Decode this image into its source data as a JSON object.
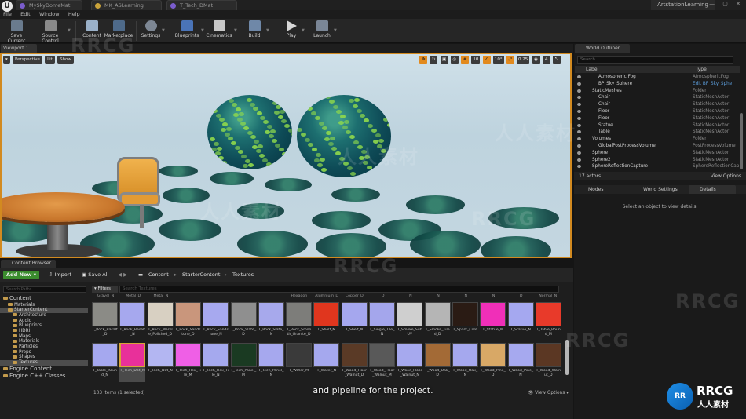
{
  "app": {
    "project_name": "ArtstationLearning",
    "window_controls": "— ▢ ✕"
  },
  "tabs": [
    {
      "label": "MySkyDomeMat"
    },
    {
      "label": "MK_ASLearning"
    },
    {
      "label": "T_Tech_DMat"
    }
  ],
  "menu": [
    "File",
    "Edit",
    "Window",
    "Help"
  ],
  "toolbar": [
    {
      "label": "Save Current",
      "icon": "save-icon"
    },
    {
      "label": "Source Control",
      "icon": "source-control-icon"
    },
    {
      "label": "Content",
      "icon": "content-icon"
    },
    {
      "label": "Marketplace",
      "icon": "marketplace-icon"
    },
    {
      "label": "Settings",
      "icon": "gear-icon"
    },
    {
      "label": "Blueprints",
      "icon": "blueprint-icon"
    },
    {
      "label": "Cinematics",
      "icon": "clapper-icon"
    },
    {
      "label": "Build",
      "icon": "build-icon"
    },
    {
      "label": "Play",
      "icon": "play-icon"
    },
    {
      "label": "Launch",
      "icon": "launch-icon"
    }
  ],
  "viewport": {
    "tab_label": "Viewport 1",
    "view_mode": "Perspective",
    "lighting": "Lit",
    "show": "Show",
    "snap_grid": "10",
    "snap_rotation": "10°",
    "snap_scale": "0.25",
    "camera_speed": "4"
  },
  "outliner": {
    "tab_label": "World Outliner",
    "search_placeholder": "Search...",
    "col_label": "Label",
    "col_type": "Type",
    "rows": [
      {
        "label": "Atmospheric Fog",
        "type": "AtmosphericFog",
        "indent": 2
      },
      {
        "label": "BP_Sky_Sphere",
        "type": "Edit BP_Sky_Sphe",
        "indent": 2,
        "link": true
      },
      {
        "label": "StaticMeshes",
        "type": "Folder",
        "indent": 1
      },
      {
        "label": "Chair",
        "type": "StaticMeshActor",
        "indent": 2
      },
      {
        "label": "Chair",
        "type": "StaticMeshActor",
        "indent": 2
      },
      {
        "label": "Floor",
        "type": "StaticMeshActor",
        "indent": 2
      },
      {
        "label": "Floor",
        "type": "StaticMeshActor",
        "indent": 2
      },
      {
        "label": "Statue",
        "type": "StaticMeshActor",
        "indent": 2
      },
      {
        "label": "Table",
        "type": "StaticMeshActor",
        "indent": 2
      },
      {
        "label": "Volumes",
        "type": "Folder",
        "indent": 1
      },
      {
        "label": "GlobalPostProcessVolume",
        "type": "PostProcessVolume",
        "indent": 2
      },
      {
        "label": "Sphere",
        "type": "StaticMeshActor",
        "indent": 1
      },
      {
        "label": "Sphere2",
        "type": "StaticMeshActor",
        "indent": 1
      },
      {
        "label": "SphereReflectionCapture",
        "type": "SphereReflectionCap",
        "indent": 1
      }
    ],
    "actor_count": "17 actors",
    "view_options": "View Options"
  },
  "details": {
    "modes_tab": "Modes",
    "world_settings_tab": "World Settings",
    "details_tab": "Details",
    "empty_message": "Select an object to view details."
  },
  "content_browser": {
    "tab_label": "Content Browser",
    "add_new": "Add New",
    "import": "Import",
    "save_all": "Save All",
    "breadcrumb": [
      "Content",
      "StarterContent",
      "Textures"
    ],
    "paths_search_placeholder": "Search Paths",
    "filters": "Filters",
    "assets_search_placeholder": "Search Textures",
    "folders": [
      {
        "label": "Content",
        "level": 0,
        "big": true
      },
      {
        "label": "Materials",
        "level": 1
      },
      {
        "label": "StarterContent",
        "level": 1,
        "selected": true
      },
      {
        "label": "Architecture",
        "level": 2
      },
      {
        "label": "Audio",
        "level": 2
      },
      {
        "label": "Blueprints",
        "level": 2
      },
      {
        "label": "HDRI",
        "level": 2
      },
      {
        "label": "Maps",
        "level": 2
      },
      {
        "label": "Materials",
        "level": 2
      },
      {
        "label": "Particles",
        "level": 2
      },
      {
        "label": "Props",
        "level": 2
      },
      {
        "label": "Shapes",
        "level": 2
      },
      {
        "label": "Textures",
        "level": 2,
        "selected": true
      },
      {
        "label": "Engine Content",
        "level": 0,
        "big": true
      },
      {
        "label": "Engine C++ Classes",
        "level": 0,
        "big": true
      }
    ],
    "top_labels": [
      "Gravel_N",
      "Metal_D",
      "Metal_N",
      "",
      "",
      "",
      "",
      "Hexagon",
      "Alumnium_D",
      "Copper_D",
      "_D",
      "_N",
      "_N",
      "_N",
      "_N",
      "_D",
      "Normal_N",
      "_N",
      "_N"
    ],
    "row1": [
      {
        "name": "T_Rock_Basalt_D",
        "color": "#8b8b86"
      },
      {
        "name": "T_Rock_Basalt_N",
        "color": "#a6a8ee"
      },
      {
        "name": "T_Rock_Marble_Polished_D",
        "color": "#d8d0c2"
      },
      {
        "name": "T_Rock_Sandstone_D",
        "color": "#c9967c"
      },
      {
        "name": "T_Rock_Sandstone_N",
        "color": "#a7a9ef"
      },
      {
        "name": "T_Rock_Slate_D",
        "color": "#8f8f8f"
      },
      {
        "name": "T_Rock_Slate_N",
        "color": "#a7a9ec"
      },
      {
        "name": "T_Rock_Smooth_Granite_D",
        "color": "#7d7d7a"
      },
      {
        "name": "T_Shelf_M",
        "color": "#e0361e"
      },
      {
        "name": "T_Shelf_N",
        "color": "#a5a7ee"
      },
      {
        "name": "T_Single_Tile_N",
        "color": "#a4a6ec"
      },
      {
        "name": "T_Smoke_SubUV",
        "color": "#cfcfcf"
      },
      {
        "name": "T_Smoke_Tiled_D",
        "color": "#b5b5b5"
      },
      {
        "name": "T_Spark_Core",
        "color": "#2a1b14"
      },
      {
        "name": "T_Statue_M",
        "color": "#f02fb8"
      },
      {
        "name": "T_Statue_N",
        "color": "#a5a8f0"
      },
      {
        "name": "T_Table_Round_M",
        "color": "#e83a2a"
      }
    ],
    "row2": [
      {
        "name": "T_Table_Round_N",
        "color": "#a5a8ef"
      },
      {
        "name": "T_Tech_Dot_M",
        "color": "#e8309a",
        "selected": true
      },
      {
        "name": "T_Tech_Dot_N",
        "color": "#b3b6f2"
      },
      {
        "name": "T_Tech_Hex_Tile_M",
        "color": "#ef5fe6"
      },
      {
        "name": "T_Tech_Hex_Tile_N",
        "color": "#a5a9ee"
      },
      {
        "name": "T_Tech_Panel_M",
        "color": "#1a3a22"
      },
      {
        "name": "T_Tech_Panel_N",
        "color": "#a6a8ee"
      },
      {
        "name": "T_Water_M",
        "color": "#3a3a3a"
      },
      {
        "name": "T_Water_N",
        "color": "#a5a8ee"
      },
      {
        "name": "T_Wood_Floor_Walnut_D",
        "color": "#5a3a26"
      },
      {
        "name": "T_Wood_Floor_Walnut_M",
        "color": "#595959"
      },
      {
        "name": "T_Wood_Floor_Walnut_N",
        "color": "#a6a9ee"
      },
      {
        "name": "T_Wood_Oak_D",
        "color": "#a36a36"
      },
      {
        "name": "T_Wood_Oak_N",
        "color": "#a5a8ee"
      },
      {
        "name": "T_Wood_Pine_D",
        "color": "#d8a866"
      },
      {
        "name": "T_Wood_Pine_N",
        "color": "#a6a9ef"
      },
      {
        "name": "T_Wood_Walnut_D",
        "color": "#5b3723"
      }
    ],
    "status": "103 items (1 selected)",
    "view_options": "View Options"
  },
  "subtitle": "and pipeline for the project.",
  "watermark": {
    "text": "RRCG",
    "cn": "人人素材"
  },
  "colors": {
    "accent": "#d28a20",
    "add_new": "#3b8c2e",
    "selection": "#d7a437"
  }
}
